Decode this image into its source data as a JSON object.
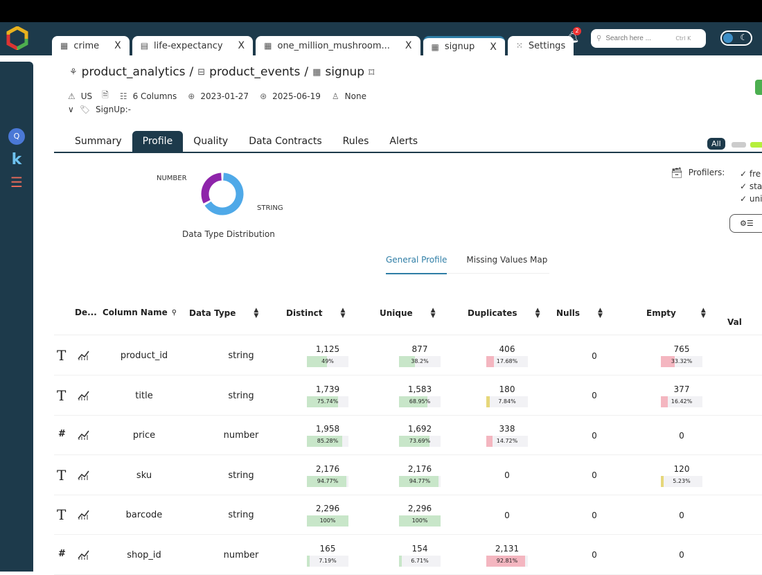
{
  "app": {
    "tabs": [
      {
        "label": "crime",
        "icon": "table-icon"
      },
      {
        "label": "life-expectancy",
        "icon": "file-icon"
      },
      {
        "label": "one_million_mushroom...",
        "icon": "table-icon"
      },
      {
        "label": "signup",
        "icon": "table-icon",
        "active": true
      },
      {
        "label": "Settings",
        "icon": "grid-icon"
      }
    ],
    "close_label": "X",
    "notifications": "2",
    "search_placeholder": "Search here ...",
    "search_shortcut": "Ctrl K"
  },
  "breadcrumb": {
    "items": [
      "product_analytics",
      "product_events",
      "signup"
    ],
    "sep": "/"
  },
  "meta": {
    "region": "US",
    "columns": "6 Columns",
    "created": "2023-01-27",
    "updated": "2025-06-19",
    "owner": "None",
    "tag": "SignUp:-"
  },
  "tabs": [
    "Summary",
    "Profile",
    "Quality",
    "Data Contracts",
    "Rules",
    "Alerts"
  ],
  "active_tab": "Profile",
  "filter": {
    "all": "All"
  },
  "chart_data": {
    "type": "pie",
    "title": "Data Type Distribution",
    "categories": [
      "NUMBER",
      "STRING"
    ],
    "values": [
      2,
      4
    ],
    "colors": [
      "#8e24aa",
      "#4fa9e8"
    ]
  },
  "profilers": {
    "label": "Profilers:",
    "items": [
      "fre",
      "sta",
      "uni"
    ]
  },
  "subtabs": [
    "General Profile",
    "Missing Values Map"
  ],
  "table": {
    "headers": [
      "De...",
      "Column Name",
      "Data Type",
      "Distinct",
      "Unique",
      "Duplicates",
      "Nulls",
      "Empty",
      "Val"
    ],
    "rows": [
      {
        "type_icon": "text",
        "name": "product_id",
        "dtype": "string",
        "distinct": "1,125",
        "distinct_pct": "49%",
        "unique": "877",
        "unique_pct": "38.2%",
        "dup": "406",
        "dup_pct": "17.68%",
        "nulls": "0",
        "empty": "765",
        "empty_pct": "33.32%"
      },
      {
        "type_icon": "text",
        "name": "title",
        "dtype": "string",
        "distinct": "1,739",
        "distinct_pct": "75.74%",
        "unique": "1,583",
        "unique_pct": "68.95%",
        "dup": "180",
        "dup_pct": "7.84%",
        "nulls": "0",
        "empty": "377",
        "empty_pct": "16.42%"
      },
      {
        "type_icon": "hash",
        "name": "price",
        "dtype": "number",
        "distinct": "1,958",
        "distinct_pct": "85.28%",
        "unique": "1,692",
        "unique_pct": "73.69%",
        "dup": "338",
        "dup_pct": "14.72%",
        "nulls": "0",
        "empty": "0",
        "empty_pct": ""
      },
      {
        "type_icon": "text",
        "name": "sku",
        "dtype": "string",
        "distinct": "2,176",
        "distinct_pct": "94.77%",
        "unique": "2,176",
        "unique_pct": "94.77%",
        "dup": "0",
        "dup_pct": "",
        "nulls": "0",
        "empty": "120",
        "empty_pct": "5.23%"
      },
      {
        "type_icon": "text",
        "name": "barcode",
        "dtype": "string",
        "distinct": "2,296",
        "distinct_pct": "100%",
        "unique": "2,296",
        "unique_pct": "100%",
        "dup": "0",
        "dup_pct": "",
        "nulls": "0",
        "empty": "0",
        "empty_pct": ""
      },
      {
        "type_icon": "hash",
        "name": "shop_id",
        "dtype": "number",
        "distinct": "165",
        "distinct_pct": "7.19%",
        "unique": "154",
        "unique_pct": "6.71%",
        "dup": "2,131",
        "dup_pct": "92.81%",
        "nulls": "0",
        "empty": "0",
        "empty_pct": ""
      }
    ]
  },
  "colors": {
    "primary": "#1d3a4b",
    "accent": "#2f7ea6",
    "good": "#c8e6c9",
    "bad": "#f4b6c0",
    "warn": "#e6d77a"
  }
}
